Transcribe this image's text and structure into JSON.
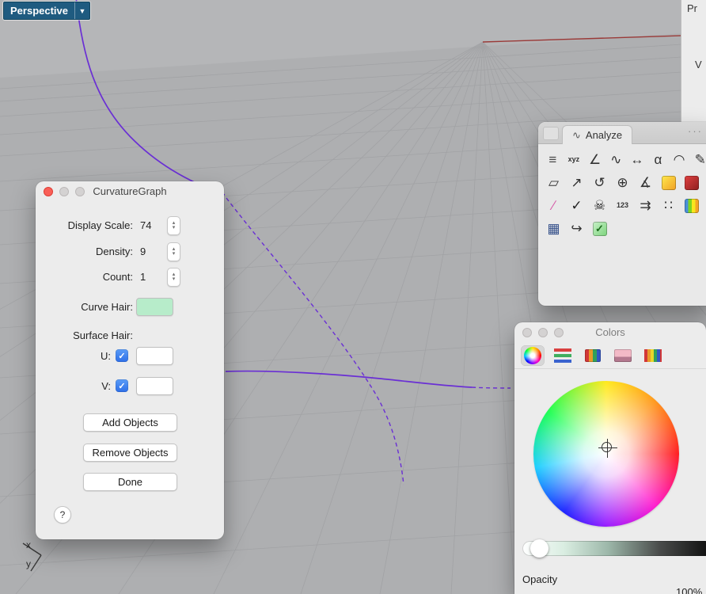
{
  "viewport": {
    "label": "Perspective",
    "dropdown_glyph": "▼",
    "curve_color": "#6a2fd4",
    "axis_color": "#9a3a38",
    "axis_x_label": "x",
    "axis_y_label": "y"
  },
  "side_strip": {
    "properties_label": "Pr",
    "v_label": "V"
  },
  "curvature_dialog": {
    "title": "CurvatureGraph",
    "stepper_up_glyph": "▴",
    "stepper_down_glyph": "▾",
    "check_glyph": "✓",
    "fields": [
      {
        "label": "Display Scale:",
        "value": "74"
      },
      {
        "label": "Density:",
        "value": "9"
      },
      {
        "label": "Count:",
        "value": "1"
      }
    ],
    "curve_hair_label": "Curve Hair:",
    "curve_hair_color": "#b7ecca",
    "surface_hair_label": "Surface Hair:",
    "u_label": "U:",
    "v_label": "V:",
    "add_button": "Add Objects",
    "remove_button": "Remove Objects",
    "done_button": "Done",
    "help_button": "?"
  },
  "analyze_palette": {
    "title": "Analyze",
    "tab_icon_glyph": "∿",
    "overflow_dots": "···",
    "rows": [
      [
        {
          "name": "palette-menu",
          "glyph": "≡",
          "fg": "#4a4a4a"
        },
        {
          "name": "evaluate-point-xyz",
          "glyph": "xyz",
          "fg": "#333333"
        },
        {
          "name": "measure-angle",
          "glyph": "∠",
          "fg": "#333333"
        },
        {
          "name": "curvature-graph",
          "glyph": "∿",
          "fg": "#333333"
        },
        {
          "name": "measure-length",
          "glyph": "↔",
          "fg": "#333333"
        },
        {
          "name": "angle-alpha",
          "glyph": "α",
          "fg": "#333333"
        },
        {
          "name": "measure-radius",
          "glyph": "◠",
          "fg": "#333333"
        },
        {
          "name": "annotate-pencil",
          "glyph": "✎",
          "fg": "#333333"
        }
      ],
      [
        {
          "name": "fit-plane",
          "glyph": "▱",
          "fg": "#333333"
        },
        {
          "name": "curve-tangent",
          "glyph": "↗",
          "fg": "#333333"
        },
        {
          "name": "curvature-circle",
          "glyph": "↺",
          "fg": "#333333"
        },
        {
          "name": "compass-axes",
          "glyph": "⊕",
          "fg": "#333333"
        },
        {
          "name": "dimension-angle",
          "glyph": "∡",
          "fg": "#333333"
        },
        {
          "name": "surface-analysis",
          "glyph": "",
          "bg": "linear-gradient(135deg,#ffe94d,#f0a024)"
        },
        {
          "name": "draft-angle-analysis",
          "glyph": "",
          "bg": "linear-gradient(135deg,#e04040,#8e1f1f)"
        }
      ],
      [
        {
          "name": "curve-deviation",
          "glyph": "∕",
          "fg": "#d65ca8"
        },
        {
          "name": "check-object",
          "glyph": "✓",
          "fg": "#222222"
        },
        {
          "name": "bad-objects",
          "glyph": "☠",
          "fg": "#222222"
        },
        {
          "name": "count-objects",
          "glyph": "123",
          "fg": "#333333"
        },
        {
          "name": "show-direction",
          "glyph": "⇉",
          "fg": "#333333"
        },
        {
          "name": "point-deviation",
          "glyph": "∷",
          "fg": "#333333"
        },
        {
          "name": "histogram",
          "glyph": "",
          "bg": "linear-gradient(90deg,#4a90d9 0 25%,#7ed321 25% 50%,#f8e71c 50% 75%,#f5a623 75% 100%)"
        }
      ],
      [
        {
          "name": "bounding-box",
          "glyph": "▦",
          "fg": "#35508a"
        },
        {
          "name": "probe-hook",
          "glyph": "↪",
          "fg": "#333333"
        },
        {
          "name": "audit-check",
          "glyph": "✓",
          "fg": "#1d6b1d",
          "bg": "linear-gradient(135deg,#c8f0c8,#7bd37b)"
        }
      ]
    ]
  },
  "colors_panel": {
    "title": "Colors",
    "tools": [
      {
        "name": "color-wheel",
        "type": "wheel",
        "selected": true
      },
      {
        "name": "color-sliders",
        "type": "sliders"
      },
      {
        "name": "color-palette",
        "type": "palette"
      },
      {
        "name": "color-image",
        "type": "image"
      },
      {
        "name": "color-pencils",
        "type": "pencils"
      }
    ],
    "opacity_label": "Opacity",
    "opacity_value": "100%"
  }
}
